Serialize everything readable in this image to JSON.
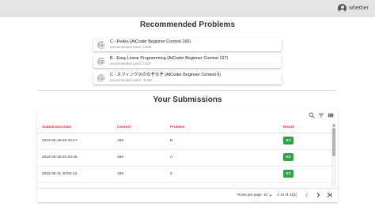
{
  "header": {
    "username": "whether"
  },
  "recommended": {
    "title": "Recommended Problems",
    "items": [
      {
        "name": "C - Peaks (AtCoder Beginner Contest 166)",
        "point": "recommended point: 0.586"
      },
      {
        "name": "B - Easy Linear Programming (AtCoder Beginner Contest 167)",
        "point": "recommended point: 0.347"
      },
      {
        "name": "C - スフィンクスのなぞなぞ (AtCoder Beginner Contest 6)",
        "point": "recommended point: -0.402"
      }
    ]
  },
  "submissions": {
    "title": "Your Submissions",
    "toolbar": [
      "search-icon",
      "filter-icon",
      "view-column-icon"
    ],
    "columns": [
      "Submission Date",
      "Contest",
      "Problem",
      "Result"
    ],
    "rows": [
      {
        "date": "2022-06-18 20:34:17",
        "contest": "166",
        "problem": "B",
        "result": "AC"
      },
      {
        "date": "2022-06-18 20:20:46",
        "contest": "166",
        "problem": "A",
        "result": "AC"
      },
      {
        "date": "2022-06-11 20:54:14",
        "contest": "188",
        "problem": "C",
        "result": "AC"
      }
    ],
    "footer": {
      "rows_per_page_label": "Rows per page",
      "rows_per_page_value": "10",
      "range": "1-10 of 418"
    }
  },
  "colors": {
    "accent_header_text": "#e0334b",
    "ac_badge": "#35a04a",
    "topbar": "#e4e4e4"
  }
}
